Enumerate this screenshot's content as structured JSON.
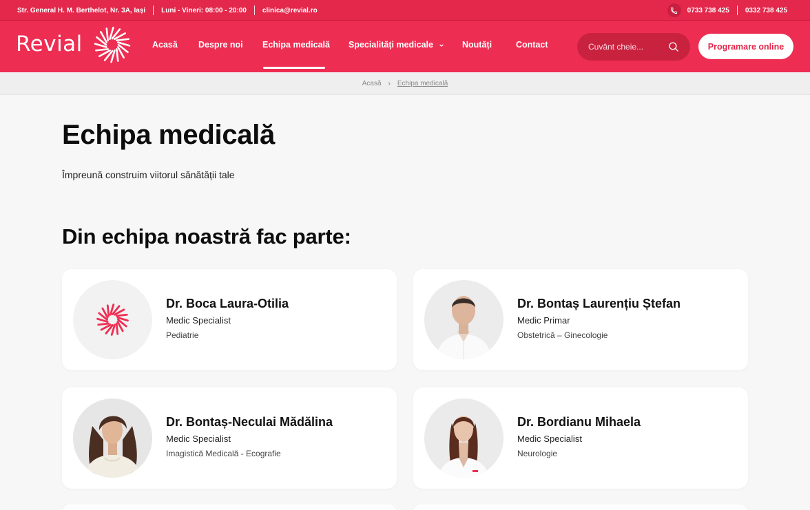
{
  "topbar": {
    "address": "Str. General H. M. Berthelot, Nr. 3A, Iași",
    "hours": "Luni - Vineri: 08:00 - 20:00",
    "email": "clinica@revial.ro",
    "phone1": "0733 738 425",
    "phone2": "0332 738 425"
  },
  "header": {
    "logo": "Revial",
    "nav": [
      {
        "label": "Acasă"
      },
      {
        "label": "Despre noi"
      },
      {
        "label": "Echipa medicală",
        "active": true
      },
      {
        "label": "Specialități medicale",
        "has_dropdown": true
      },
      {
        "label": "Noutăți"
      },
      {
        "label": "Contact"
      }
    ],
    "search_placeholder": "Cuvânt cheie...",
    "cta": "Programare online"
  },
  "breadcrumb": {
    "home": "Acasă",
    "separator": "›",
    "current": "Echipa medicală"
  },
  "main": {
    "title": "Echipa medicală",
    "subtitle": "Împreună construim viitorul sănătății tale",
    "section_title": "Din echipa noastră fac parte:",
    "doctors": [
      {
        "name": "Dr. Boca Laura-Otilia",
        "role": "Medic Specialist",
        "specialty": "Pediatrie",
        "avatar": "logo-placeholder"
      },
      {
        "name": "Dr. Bontaș Laurențiu Ștefan",
        "role": "Medic Primar",
        "specialty": "Obstetrică – Ginecologie",
        "avatar": "photo-male"
      },
      {
        "name": "Dr. Bontaș-Neculai Mădălina",
        "role": "Medic Specialist",
        "specialty": "Imagistică Medicală - Ecografie",
        "avatar": "photo-female-curly"
      },
      {
        "name": "Dr. Bordianu Mihaela",
        "role": "Medic Specialist",
        "specialty": "Neurologie",
        "avatar": "photo-female-long-hair"
      }
    ]
  },
  "colors": {
    "brand": "#ee2d52",
    "topbar": "#e3284b",
    "search_bg": "#c8223f",
    "page_bg": "#f7f7f7"
  }
}
